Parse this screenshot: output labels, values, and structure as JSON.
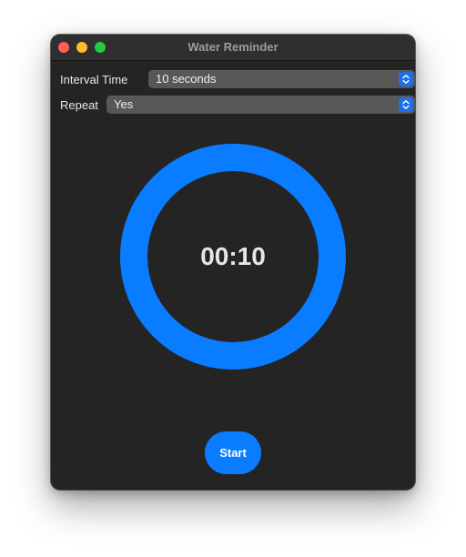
{
  "window": {
    "title": "Water Reminder"
  },
  "settings": {
    "interval": {
      "label": "Interval Time",
      "value": "10 seconds",
      "icon": "chevron-up-down-icon"
    },
    "repeat": {
      "label": "Repeat",
      "value": "Yes",
      "icon": "chevron-up-down-icon"
    }
  },
  "timer": {
    "display": "00:10",
    "progress": 1.0
  },
  "actions": {
    "start_label": "Start"
  },
  "colors": {
    "accent": "#0a7cff",
    "background": "#242424",
    "select_background": "#575757",
    "close": "#fe5f57",
    "minimize": "#febc2e",
    "maximize": "#28c840"
  }
}
